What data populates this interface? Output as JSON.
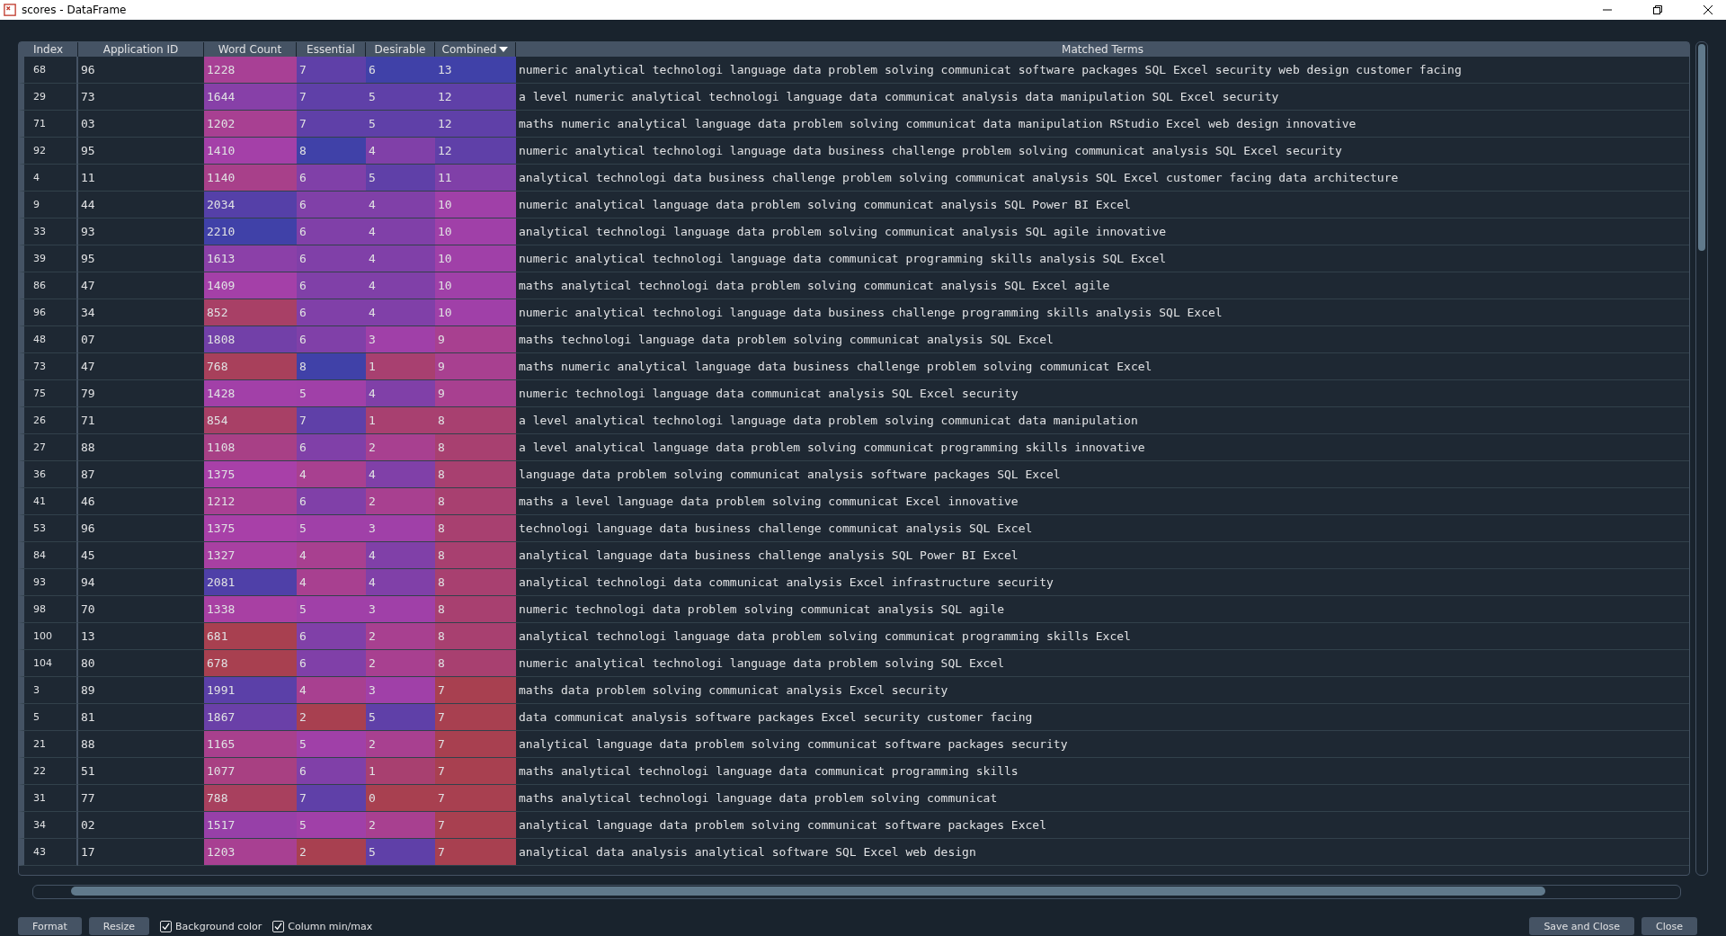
{
  "window": {
    "title": "scores - DataFrame"
  },
  "table": {
    "index_header": "Index",
    "columns": [
      {
        "label": "Application ID",
        "kind": "plain",
        "sorted": false
      },
      {
        "label": "Word Count",
        "kind": "heatmap",
        "sorted": false
      },
      {
        "label": "Essential",
        "kind": "heatmap",
        "sorted": false
      },
      {
        "label": "Desirable",
        "kind": "heatmap",
        "sorted": false
      },
      {
        "label": "Combined",
        "kind": "heatmap",
        "sorted": true
      },
      {
        "label": "Matched Terms",
        "kind": "plain",
        "sorted": false
      }
    ],
    "rows": [
      {
        "index": "68",
        "cells": [
          "96",
          "1228",
          "7",
          "6",
          "13",
          "numeric analytical technologi language data problem solving communicat software packages SQL Excel security web design customer facing"
        ]
      },
      {
        "index": "29",
        "cells": [
          "73",
          "1644",
          "7",
          "5",
          "12",
          "a level numeric analytical technologi language data communicat analysis data manipulation SQL Excel security"
        ]
      },
      {
        "index": "71",
        "cells": [
          "03",
          "1202",
          "7",
          "5",
          "12",
          "maths numeric analytical language data problem solving communicat data manipulation RStudio Excel web design innovative"
        ]
      },
      {
        "index": "92",
        "cells": [
          "95",
          "1410",
          "8",
          "4",
          "12",
          "numeric analytical technologi language data business challenge problem solving communicat analysis SQL Excel security"
        ]
      },
      {
        "index": "4",
        "cells": [
          "11",
          "1140",
          "6",
          "5",
          "11",
          "analytical technologi data business challenge problem solving communicat analysis SQL Excel customer facing data architecture"
        ]
      },
      {
        "index": "9",
        "cells": [
          "44",
          "2034",
          "6",
          "4",
          "10",
          "numeric analytical language data problem solving communicat analysis SQL Power BI Excel"
        ]
      },
      {
        "index": "33",
        "cells": [
          "93",
          "2210",
          "6",
          "4",
          "10",
          "analytical technologi language data problem solving communicat analysis SQL agile innovative"
        ]
      },
      {
        "index": "39",
        "cells": [
          "95",
          "1613",
          "6",
          "4",
          "10",
          "numeric analytical technologi language data communicat programming skills analysis SQL Excel"
        ]
      },
      {
        "index": "86",
        "cells": [
          "47",
          "1409",
          "6",
          "4",
          "10",
          "maths analytical technologi data problem solving communicat analysis SQL Excel agile"
        ]
      },
      {
        "index": "96",
        "cells": [
          "34",
          "852",
          "6",
          "4",
          "10",
          "numeric analytical technologi language data business challenge programming skills analysis SQL Excel"
        ]
      },
      {
        "index": "48",
        "cells": [
          "07",
          "1808",
          "6",
          "3",
          "9",
          "maths technologi language data problem solving communicat analysis SQL Excel"
        ]
      },
      {
        "index": "73",
        "cells": [
          "47",
          "768",
          "8",
          "1",
          "9",
          "maths numeric analytical language data business challenge problem solving communicat Excel"
        ]
      },
      {
        "index": "75",
        "cells": [
          "79",
          "1428",
          "5",
          "4",
          "9",
          "numeric technologi language data communicat analysis SQL Excel security"
        ]
      },
      {
        "index": "26",
        "cells": [
          "71",
          "854",
          "7",
          "1",
          "8",
          "a level analytical technologi language data problem solving communicat data manipulation"
        ]
      },
      {
        "index": "27",
        "cells": [
          "88",
          "1108",
          "6",
          "2",
          "8",
          "a level analytical language data problem solving communicat programming skills innovative"
        ]
      },
      {
        "index": "36",
        "cells": [
          "87",
          "1375",
          "4",
          "4",
          "8",
          "language data problem solving communicat analysis software packages SQL Excel"
        ]
      },
      {
        "index": "41",
        "cells": [
          "46",
          "1212",
          "6",
          "2",
          "8",
          "maths a level language data problem solving communicat Excel innovative"
        ]
      },
      {
        "index": "53",
        "cells": [
          "96",
          "1375",
          "5",
          "3",
          "8",
          "technologi language data business challenge communicat analysis SQL Excel"
        ]
      },
      {
        "index": "84",
        "cells": [
          "45",
          "1327",
          "4",
          "4",
          "8",
          "analytical language data business challenge analysis SQL Power BI Excel"
        ]
      },
      {
        "index": "93",
        "cells": [
          "94",
          "2081",
          "4",
          "4",
          "8",
          "analytical technologi data communicat analysis Excel infrastructure security"
        ]
      },
      {
        "index": "98",
        "cells": [
          "70",
          "1338",
          "5",
          "3",
          "8",
          "numeric technologi data problem solving communicat analysis SQL agile"
        ]
      },
      {
        "index": "100",
        "cells": [
          "13",
          "681",
          "6",
          "2",
          "8",
          "analytical technologi language data problem solving communicat programming skills Excel"
        ]
      },
      {
        "index": "104",
        "cells": [
          "80",
          "678",
          "6",
          "2",
          "8",
          "numeric analytical technologi language data problem solving SQL Excel"
        ]
      },
      {
        "index": "3",
        "cells": [
          "89",
          "1991",
          "4",
          "3",
          "7",
          "maths data problem solving communicat analysis Excel security"
        ]
      },
      {
        "index": "5",
        "cells": [
          "81",
          "1867",
          "2",
          "5",
          "7",
          "data communicat analysis software packages Excel security customer facing"
        ]
      },
      {
        "index": "21",
        "cells": [
          "88",
          "1165",
          "5",
          "2",
          "7",
          "analytical language data problem solving communicat software packages security"
        ]
      },
      {
        "index": "22",
        "cells": [
          "51",
          "1077",
          "6",
          "1",
          "7",
          "maths analytical technologi language data communicat programming skills"
        ]
      },
      {
        "index": "31",
        "cells": [
          "77",
          "788",
          "7",
          "0",
          "7",
          "maths analytical technologi language data problem solving communicat"
        ]
      },
      {
        "index": "34",
        "cells": [
          "02",
          "1517",
          "5",
          "2",
          "7",
          "analytical language data problem solving communicat software packages Excel"
        ]
      },
      {
        "index": "43",
        "cells": [
          "17",
          "1203",
          "2",
          "5",
          "7",
          "analytical data analysis analytical software SQL Excel web design"
        ]
      }
    ]
  },
  "buttons_left": [
    "Format",
    "Resize"
  ],
  "options": [
    {
      "label": "Background color",
      "checked": true
    },
    {
      "label": "Column min/max",
      "checked": true
    }
  ],
  "buttons_right": [
    "Save and Close",
    "Close"
  ]
}
